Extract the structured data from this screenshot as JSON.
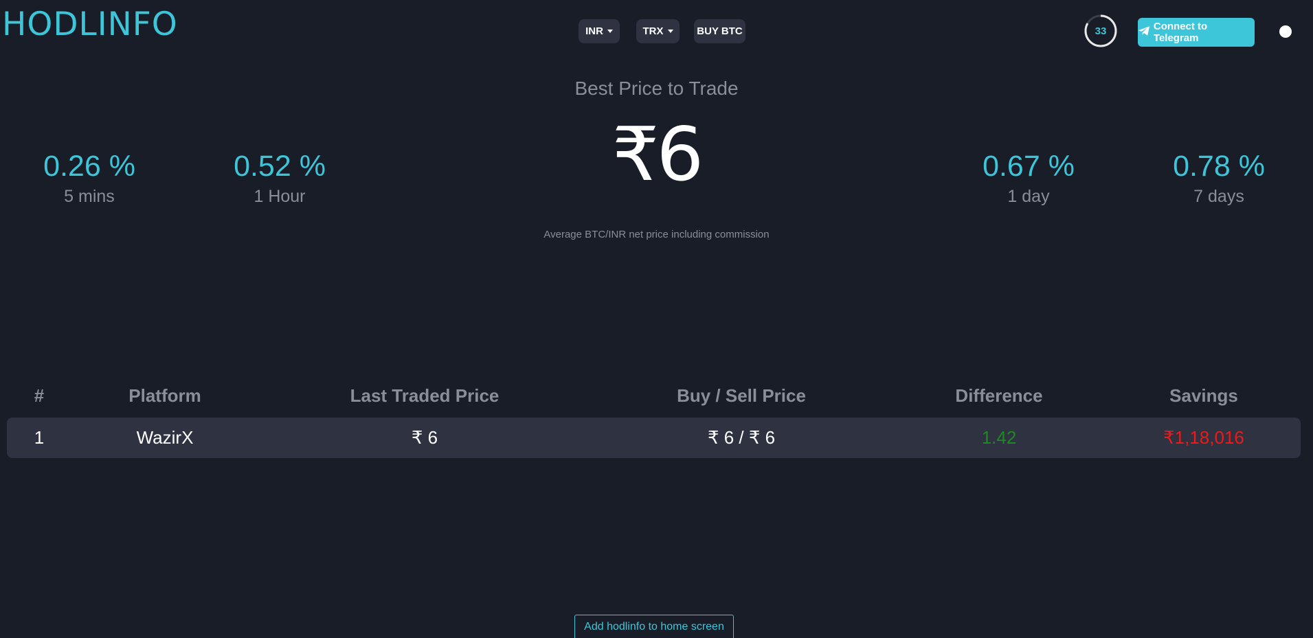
{
  "header": {
    "logo": "HODLINFO",
    "currency_label": "INR",
    "coin_label": "TRX",
    "buy_label": "BUY BTC",
    "timer_value": "33",
    "telegram_label": "Connect to Telegram",
    "theme_toggle": "dark"
  },
  "hero": {
    "title": "Best Price to Trade",
    "price": "₹6",
    "subtitle": "Average BTC/INR net price including commission"
  },
  "stats": [
    {
      "value": "0.26 %",
      "label": "5 mins"
    },
    {
      "value": "0.52 %",
      "label": "1 Hour"
    },
    {
      "value": "0.67 %",
      "label": "1 day"
    },
    {
      "value": "0.78 %",
      "label": "7 days"
    }
  ],
  "table": {
    "headers": [
      "#",
      "Platform",
      "Last Traded Price",
      "Buy / Sell Price",
      "Difference",
      "Savings"
    ],
    "rows": [
      {
        "rank": "1",
        "platform": "WazirX",
        "last_price": "₹ 6",
        "buy_sell": "₹ 6 / ₹ 6",
        "difference": "1.42",
        "savings": "₹1,18,016"
      }
    ]
  },
  "footer": {
    "add_home_label": "Add hodlinfo to home screen"
  },
  "colors": {
    "background": "#191d28",
    "accent": "#3dc6d9",
    "card": "#2e3241",
    "muted": "#8a8e9a",
    "positive": "#1b8a1f",
    "negative": "#ec1a1a"
  }
}
